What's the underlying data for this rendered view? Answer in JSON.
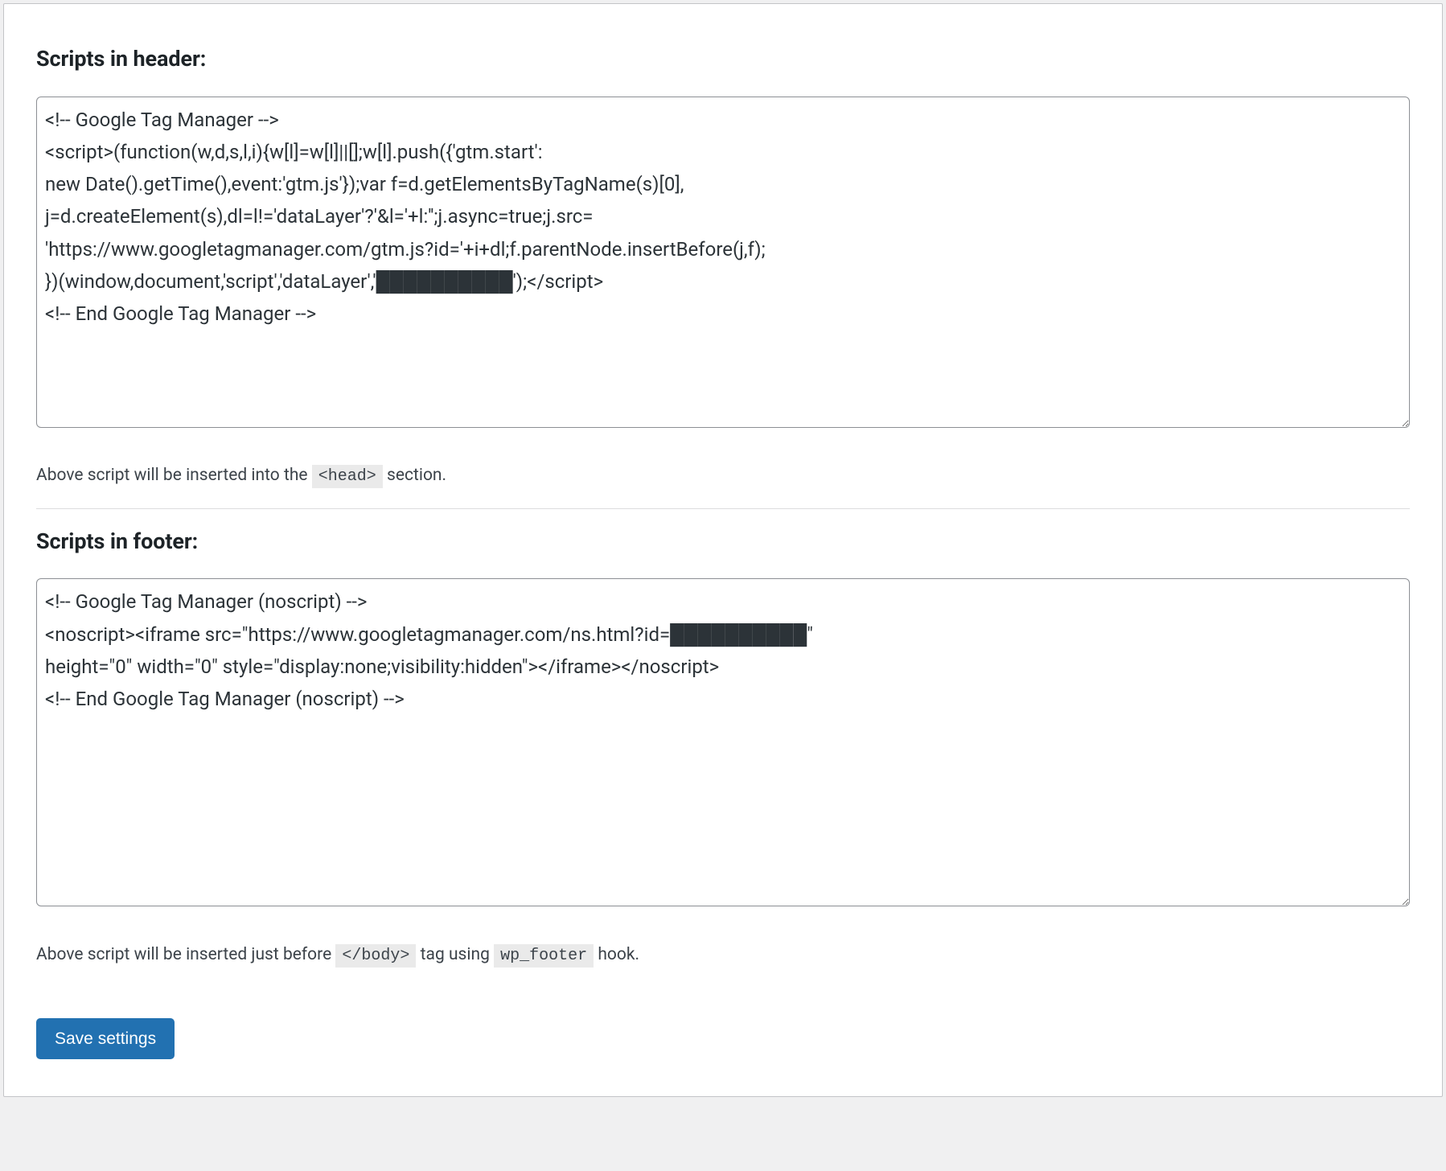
{
  "header_section": {
    "heading": "Scripts in header:",
    "textarea_value": "<!-- Google Tag Manager -->\n<script>(function(w,d,s,l,i){w[l]=w[l]||[];w[l].push({'gtm.start':\nnew Date().getTime(),event:'gtm.js'});var f=d.getElementsByTagName(s)[0],\nj=d.createElement(s),dl=l!='dataLayer'?'&l='+l:'';j.async=true;j.src=\n'https://www.googletagmanager.com/gtm.js?id='+i+dl;f.parentNode.insertBefore(j,f);\n})(window,document,'script','dataLayer','██████████');</script>\n<!-- End Google Tag Manager -->",
    "helper_prefix": "Above script will be inserted into the ",
    "helper_code": "<head>",
    "helper_suffix": " section."
  },
  "footer_section": {
    "heading": "Scripts in footer:",
    "textarea_value": "<!-- Google Tag Manager (noscript) -->\n<noscript><iframe src=\"https://www.googletagmanager.com/ns.html?id=██████████\"\nheight=\"0\" width=\"0\" style=\"display:none;visibility:hidden\"></iframe></noscript>\n<!-- End Google Tag Manager (noscript) -->",
    "helper_prefix": "Above script will be inserted just before ",
    "helper_code1": "</body>",
    "helper_mid": " tag using ",
    "helper_code2": "wp_footer",
    "helper_suffix": " hook."
  },
  "actions": {
    "save_label": "Save settings"
  }
}
